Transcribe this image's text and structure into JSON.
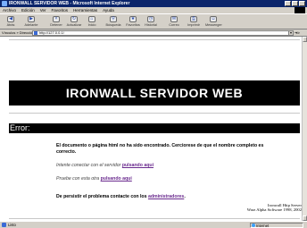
{
  "window": {
    "title": "IRONWALL SERVIDOR WEB - Microsoft Internet Explorer"
  },
  "menu": [
    "Archivo",
    "Edición",
    "Ver",
    "Favoritos",
    "Herramientas",
    "Ayuda"
  ],
  "toolbar": [
    {
      "label": "Atrás",
      "icon": "back-arrow-icon"
    },
    {
      "label": "Adelante",
      "icon": "forward-arrow-icon"
    },
    {
      "label": "Detener",
      "icon": "stop-icon"
    },
    {
      "label": "Actualizar",
      "icon": "refresh-icon"
    },
    {
      "label": "Inicio",
      "icon": "home-icon"
    },
    {
      "label": "Búsqueda",
      "icon": "search-icon"
    },
    {
      "label": "Favoritos",
      "icon": "favorites-icon"
    },
    {
      "label": "Historial",
      "icon": "history-icon"
    },
    {
      "label": "Correo",
      "icon": "mail-icon"
    },
    {
      "label": "Imprimir",
      "icon": "print-icon"
    },
    {
      "label": "Messenger",
      "icon": "messenger-icon"
    }
  ],
  "address": {
    "menu_label": "Vínculos",
    "label": "Dirección",
    "value": "http://127.0.0.1/",
    "go_label": "Ir"
  },
  "page": {
    "banner": "IRONWALL SERVIDOR WEB",
    "error_title": "Error:",
    "message_1": "El documento o página html no ha sido encontrado. Cerciorese de que el nombre completo es correcto.",
    "retry_prefix": "Intente conectar con el servidor",
    "retry_link": "pulsando aqui",
    "site_prefix": "Pruebe con esta otra",
    "site_link": "pulsando aqui",
    "admin_prefix": "De persistir el problema contacte con los",
    "admin_link": "administradores",
    "admin_suffix": ".",
    "footer_line1": "Ironwall Http Server",
    "footer_line2": "Warz Alpha Software 1998, 2002"
  },
  "status": {
    "text": "Listo",
    "zone": "Internet"
  },
  "colors": {
    "titlebar": "#0a246a",
    "link": "#6a2a8e",
    "banner_bg": "#000000"
  }
}
